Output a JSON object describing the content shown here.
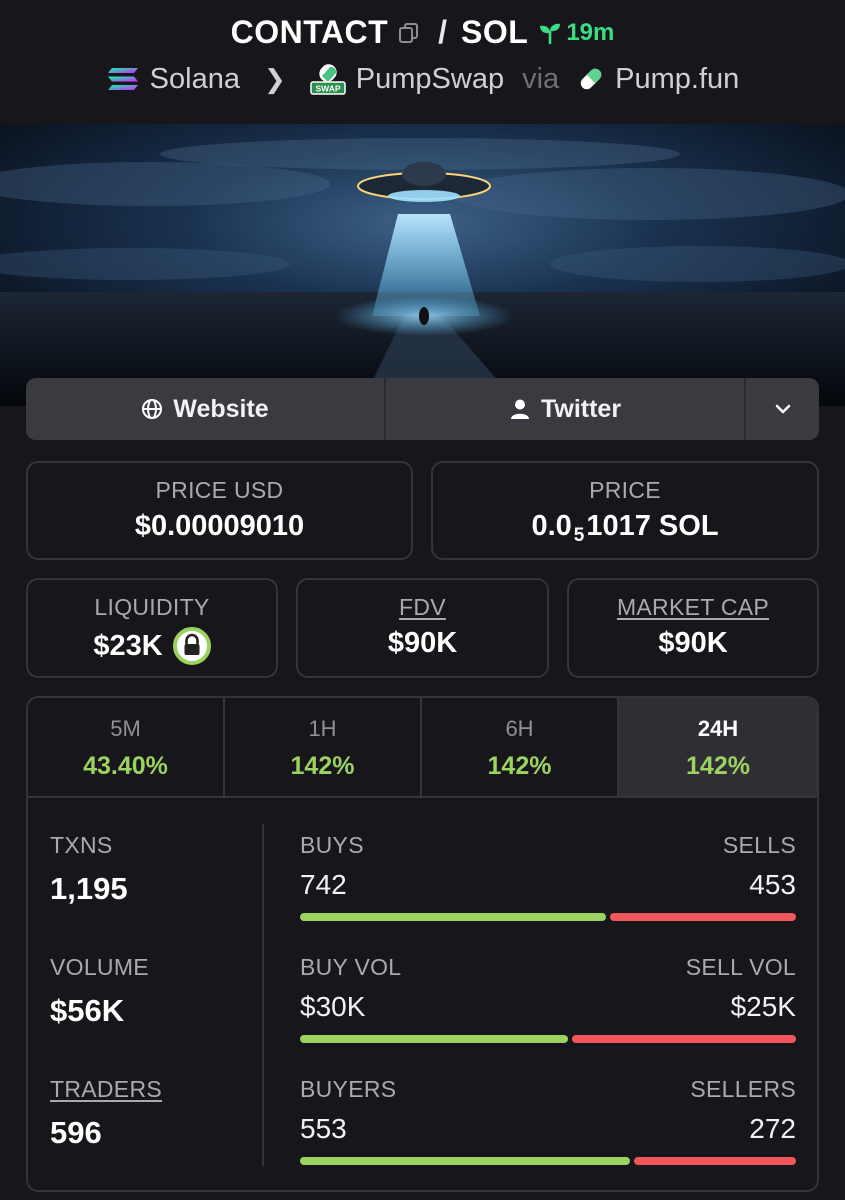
{
  "header": {
    "symbol": "CONTACT",
    "quote": "SOL",
    "age": "19m",
    "chain": "Solana",
    "dex": "PumpSwap",
    "via": "via",
    "launchpad": "Pump.fun"
  },
  "links": {
    "website": "Website",
    "twitter": "Twitter"
  },
  "prices": {
    "price_usd_label": "PRICE USD",
    "price_usd": "$0.00009010",
    "price_label": "PRICE",
    "price_prefix": "0.0",
    "price_zeros": "5",
    "price_rest": "1017 SOL"
  },
  "metrics": {
    "liquidity_label": "LIQUIDITY",
    "liquidity": "$23K",
    "fdv_label": "FDV",
    "fdv": "$90K",
    "mcap_label": "MARKET CAP",
    "mcap": "$90K"
  },
  "timeframes": [
    {
      "label": "5M",
      "change": "43.40%"
    },
    {
      "label": "1H",
      "change": "142%"
    },
    {
      "label": "6H",
      "change": "142%"
    },
    {
      "label": "24H",
      "change": "142%"
    }
  ],
  "stats": {
    "txns_label": "TXNS",
    "txns": "1,195",
    "volume_label": "VOLUME",
    "volume": "$56K",
    "traders_label": "TRADERS",
    "traders": "596"
  },
  "ratios": [
    {
      "left_label": "BUYS",
      "right_label": "SELLS",
      "left": "742",
      "right": "453",
      "left_fraction": 0.621
    },
    {
      "left_label": "BUY VOL",
      "right_label": "SELL VOL",
      "left": "$30K",
      "right": "$25K",
      "left_fraction": 0.545
    },
    {
      "left_label": "BUYERS",
      "right_label": "SELLERS",
      "left": "553",
      "right": "272",
      "left_fraction": 0.67
    }
  ],
  "colors": {
    "positive": "#9bd260",
    "negative": "#f2555a",
    "age_green": "#3ddc84",
    "background": "#17171b"
  },
  "icons": {
    "copy": "copy-icon",
    "age": "sprout-icon",
    "chain": "solana-icon",
    "dex": "pumpswap-icon",
    "launchpad": "pill-icon",
    "website": "globe-icon",
    "twitter": "user-icon",
    "more": "chevron-down-icon",
    "liquidity_locked": "lock-icon"
  }
}
